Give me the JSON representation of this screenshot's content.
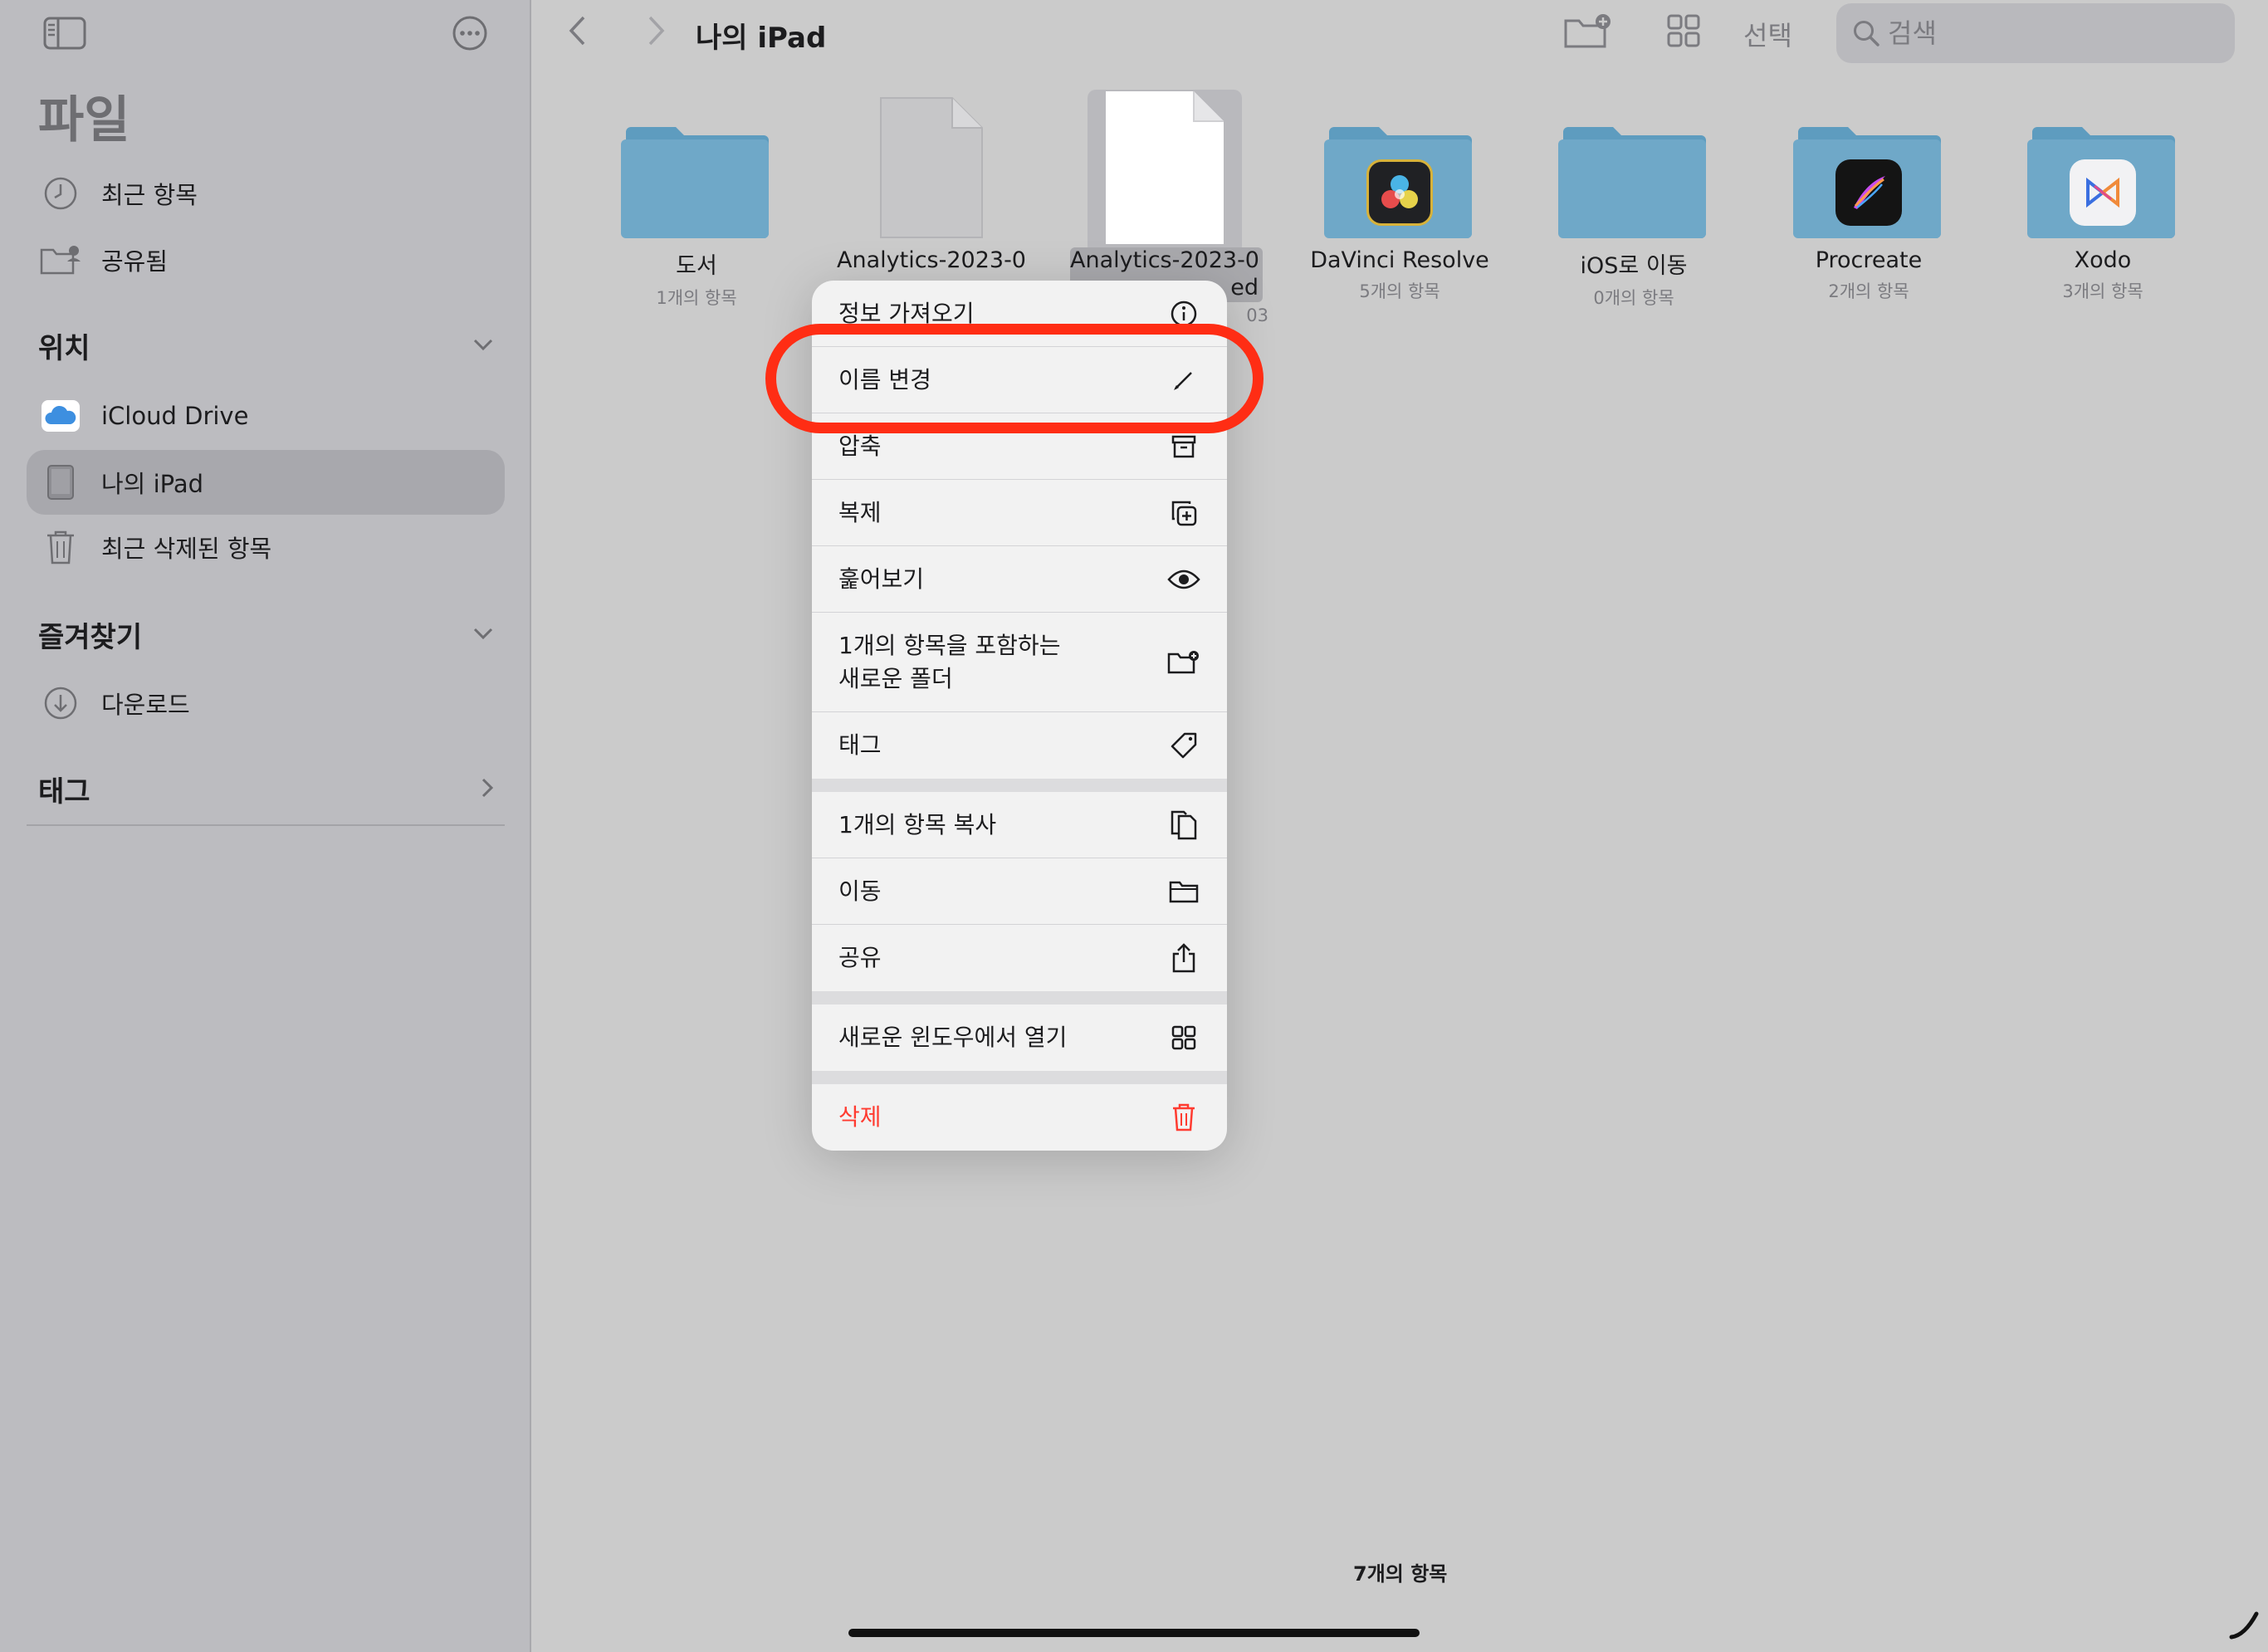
{
  "sidebar": {
    "title": "파일",
    "top_items": [
      {
        "label": "최근 항목",
        "icon": "clock-icon"
      },
      {
        "label": "공유됨",
        "icon": "shared-folder-icon"
      }
    ],
    "locations": {
      "heading": "위치",
      "items": [
        {
          "label": "iCloud Drive",
          "icon": "icloud-icon"
        },
        {
          "label": "나의 iPad",
          "icon": "ipad-icon",
          "selected": true
        },
        {
          "label": "최근 삭제된 항목",
          "icon": "trash-icon"
        }
      ]
    },
    "favorites": {
      "heading": "즐겨찾기",
      "items": [
        {
          "label": "다운로드",
          "icon": "download-icon"
        }
      ]
    },
    "tags": {
      "heading": "태그"
    }
  },
  "toolbar": {
    "title": "나의 iPad",
    "select_label": "선택",
    "search_placeholder": "검색"
  },
  "grid_items": [
    {
      "name": "도서",
      "sub": "1개의 항목",
      "kind": "folder"
    },
    {
      "name": "Analytics-2023-0",
      "sub": "",
      "kind": "document"
    },
    {
      "name": "Analytics-2023-0",
      "name_line2": "ed",
      "sub": "03",
      "kind": "document-selected"
    },
    {
      "name": "DaVinci Resolve",
      "sub": "5개의 항목",
      "kind": "app-folder",
      "icon": "davinci-resolve-icon"
    },
    {
      "name": "iOS로 이동",
      "sub": "0개의 항목",
      "kind": "folder"
    },
    {
      "name": "Procreate",
      "sub": "2개의 항목",
      "kind": "app-folder",
      "icon": "procreate-icon"
    },
    {
      "name": "Xodo",
      "sub": "3개의 항목",
      "kind": "app-folder",
      "icon": "xodo-icon"
    }
  ],
  "context_menu": {
    "groups": [
      [
        {
          "label": "정보 가져오기",
          "icon": "info-icon"
        },
        {
          "label": "이름 변경",
          "icon": "pencil-icon"
        },
        {
          "label": "압축",
          "icon": "archive-icon"
        },
        {
          "label": "복제",
          "icon": "duplicate-icon"
        },
        {
          "label": "훑어보기",
          "icon": "eye-icon"
        },
        {
          "label": "1개의 항목을 포함하는",
          "label_line2": "새로운 폴더",
          "icon": "new-folder-icon"
        },
        {
          "label": "태그",
          "icon": "tag-icon"
        }
      ],
      [
        {
          "label": "1개의 항목 복사",
          "icon": "copy-icon"
        },
        {
          "label": "이동",
          "icon": "folder-icon"
        },
        {
          "label": "공유",
          "icon": "share-icon"
        }
      ],
      [
        {
          "label": "새로운 윈도우에서 열기",
          "icon": "grid-icon"
        }
      ],
      [
        {
          "label": "삭제",
          "icon": "trash-icon",
          "destructive": true
        }
      ]
    ]
  },
  "status": {
    "item_count": "7개의 항목"
  },
  "colors": {
    "accent_red": "#ff3b30",
    "highlight_ring": "#ff2d14",
    "folder_blue": "#6fa8c8",
    "sidebar_bg": "#bcbcc0",
    "content_bg": "#cbcbcb"
  }
}
